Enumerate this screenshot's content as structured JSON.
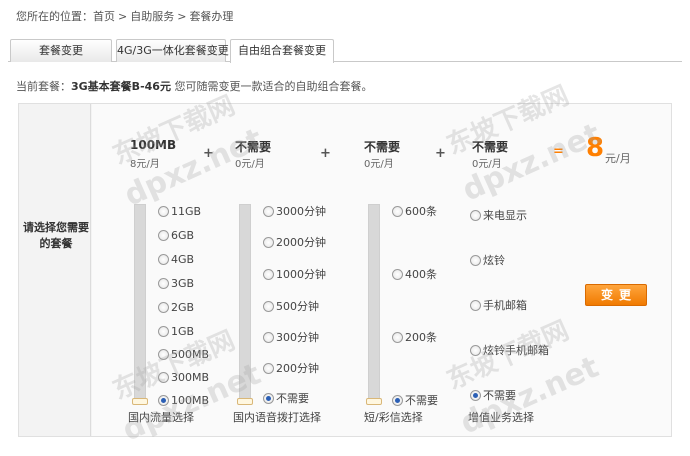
{
  "breadcrumb": {
    "prefix": "您所在的位置：",
    "items": [
      "首页",
      "自助服务",
      "套餐办理"
    ],
    "separator": ">"
  },
  "tabs": [
    {
      "label": "套餐变更",
      "active": false
    },
    {
      "label": "4G/3G一体化套餐变更",
      "active": false
    },
    {
      "label": "自由组合套餐变更",
      "active": true
    }
  ],
  "current_plan": {
    "prefix": "当前套餐：",
    "name": "3G基本套餐B-46元",
    "suffix": "您可随需变更一款适合的自助组合套餐。"
  },
  "row_label": "请选择您需要的套餐",
  "header": {
    "data": {
      "title": "100MB",
      "price": "8元/月"
    },
    "voice": {
      "title": "不需要",
      "price": "0元/月"
    },
    "sms": {
      "title": "不需要",
      "price": "0元/月"
    },
    "value_added": {
      "title": "不需要",
      "price": "0元/月"
    },
    "plus": "+",
    "equals": "=",
    "total_value": "8",
    "total_unit": "元/月"
  },
  "data_options": [
    "11GB",
    "6GB",
    "4GB",
    "3GB",
    "2GB",
    "1GB",
    "500MB",
    "300MB",
    "100MB"
  ],
  "data_selected_index": 8,
  "data_label": "国内流量选择",
  "voice_options": [
    "3000分钟",
    "2000分钟",
    "1000分钟",
    "500分钟",
    "300分钟",
    "200分钟",
    "不需要"
  ],
  "voice_selected_index": 6,
  "voice_label": "国内语音拨打选择",
  "sms_options": [
    "600条",
    "400条",
    "200条",
    "不需要"
  ],
  "sms_selected_index": 3,
  "sms_label": "短/彩信选择",
  "va_options": [
    "来电显示",
    "炫铃",
    "手机邮箱",
    "炫铃手机邮箱",
    "不需要"
  ],
  "va_selected_index": 4,
  "va_label": "增值业务选择",
  "change_button": "变更",
  "watermark_cn": "东坡下载网",
  "watermark_en": "dpxz.net",
  "colors": {
    "accent": "#ff7f00",
    "button": "#f07a00",
    "radio_checked": "#2b5fb5"
  }
}
